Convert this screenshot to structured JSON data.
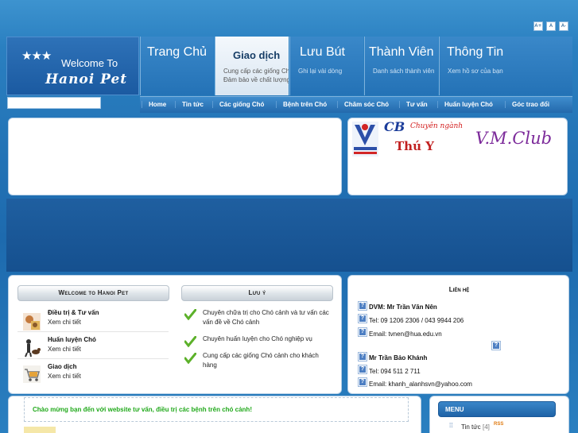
{
  "font_sizes": [
    "A+",
    "A",
    "A-"
  ],
  "logo": {
    "stars": "★★★",
    "welcome": "Welcome To",
    "script": "Hanoi Pet"
  },
  "top_nav": [
    {
      "label": "Trang Chủ",
      "sub": ""
    },
    {
      "label": "Giao dịch",
      "sub": "Cung cấp các giống Ch\nĐảm bảo về chất lượng",
      "active": true
    },
    {
      "label": "Lưu Bút",
      "sub": "Ghi lại vài dòng"
    },
    {
      "label": "Thành Viên",
      "sub": "Danh sách thành viên"
    },
    {
      "label": "Thông Tin",
      "sub": "Xem hồ sơ của bạn"
    }
  ],
  "search": {
    "value": "",
    "placeholder": ""
  },
  "sub_nav": [
    "Home",
    "Tin tức",
    "Các giống Chó",
    "Bệnh trên Chó",
    "Chăm sóc Chó",
    "Tư vấn",
    "Huấn luyện Chó",
    "Góc trao đổi"
  ],
  "banner": {
    "cb": "CB",
    "chuyen_nganh": "Chuyên ngành",
    "thu_y": "Thú Y",
    "club": "V.M.Club"
  },
  "welcome_box": {
    "title": "Welcome to Hanoi Pet",
    "services": [
      {
        "title": "Điều trị & Tư vấn",
        "link": "Xem chi tiết",
        "icon": "vet-icon"
      },
      {
        "title": "Huấn luyện Chó",
        "link": "Xem chi tiết",
        "icon": "dog-training-icon"
      },
      {
        "title": "Giao dịch",
        "link": "Xem chi tiết",
        "icon": "shopping-cart-icon"
      }
    ]
  },
  "notes_box": {
    "title": "Lưu ý",
    "items": [
      "Chuyên chữa trị cho Chó cảnh và tư vấn các vấn đề về Chó cảnh",
      "Chuyên huấn luyện cho Chó nghiệp vụ",
      "Cung cấp các giống Chó cảnh cho khách hàng"
    ]
  },
  "contact": {
    "title": "Liên hệ",
    "lines": [
      "DVM: Mr Trần Văn Nên",
      "Tel: 09 1206 2306 / 043 9944 206",
      "Email: tvnen@hua.edu.vn",
      "Mr Trần Bảo Khánh",
      "Tel: 094 511 2 711",
      "Email: khanh_alanhsvn@yahoo.com"
    ]
  },
  "welcome_message": "Chào mừng bạn đến với website tư vấn, điều trị các bệnh trên chó cảnh!",
  "menu": {
    "title": "MENU",
    "items": [
      {
        "label": "Tin tức",
        "count": "[4]",
        "rss": "RSS"
      }
    ]
  },
  "colors": {
    "page_bg": "#2a7fc0",
    "band": "#15508f",
    "welcome_green": "#21a91b",
    "check_green": "#5cb12a"
  }
}
